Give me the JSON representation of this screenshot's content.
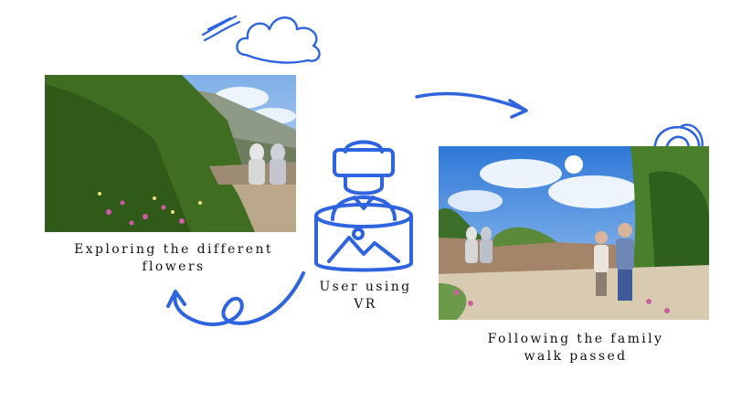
{
  "accent_color": "#2f64e0",
  "left_panel": {
    "caption_line1": "Exploring the different",
    "caption_line2": "flowers"
  },
  "center": {
    "icon": "vr-user-icon",
    "caption_line1": "User using",
    "caption_line2": "VR"
  },
  "right_panel": {
    "caption_line1": "Following the family",
    "caption_line2": "walk passed"
  },
  "doodles": [
    "cloud-icon",
    "wind-lines-icon",
    "arrow-right-icon",
    "loop-arrow-left-icon",
    "swirl-icon"
  ]
}
